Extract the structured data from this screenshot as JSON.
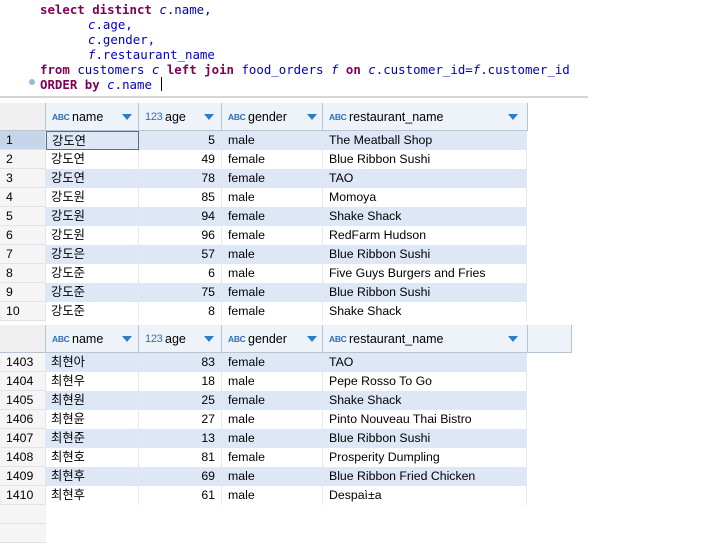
{
  "query": {
    "line1": {
      "kw": "select distinct ",
      "alias": "c",
      "rest": ".name,"
    },
    "line2": {
      "alias": "c",
      "rest": ".age,"
    },
    "line3": {
      "alias": "c",
      "rest": ".gender,"
    },
    "line4": {
      "alias": "f",
      "rest": ".restaurant_name"
    },
    "line5": {
      "kw1": "from ",
      "t1": "customers ",
      "a1": "c",
      "kw2": " left join ",
      "t2": "food_orders ",
      "a2": "f",
      "kw3": " on ",
      "a3": "c",
      "r3": ".customer_id=",
      "a4": "f",
      "r4": ".customer_id"
    },
    "line6": {
      "kw": "ORDER by ",
      "alias": "c",
      "rest": ".name "
    }
  },
  "columns": [
    {
      "type_icon": "ABC",
      "label": "name"
    },
    {
      "type_icon": "123",
      "label": "age"
    },
    {
      "type_icon": "ABC",
      "label": "gender"
    },
    {
      "type_icon": "ABC",
      "label": "restaurant_name"
    }
  ],
  "top_rows": [
    {
      "n": "1",
      "name": "강도연",
      "age": "5",
      "gender": "male",
      "restaurant": "The Meatball Shop"
    },
    {
      "n": "2",
      "name": "강도연",
      "age": "49",
      "gender": "female",
      "restaurant": "Blue Ribbon Sushi"
    },
    {
      "n": "3",
      "name": "강도연",
      "age": "78",
      "gender": "female",
      "restaurant": "TAO"
    },
    {
      "n": "4",
      "name": "강도원",
      "age": "85",
      "gender": "male",
      "restaurant": "Momoya"
    },
    {
      "n": "5",
      "name": "강도원",
      "age": "94",
      "gender": "female",
      "restaurant": "Shake Shack"
    },
    {
      "n": "6",
      "name": "강도원",
      "age": "96",
      "gender": "female",
      "restaurant": "RedFarm Hudson"
    },
    {
      "n": "7",
      "name": "강도은",
      "age": "57",
      "gender": "male",
      "restaurant": "Blue Ribbon Sushi"
    },
    {
      "n": "8",
      "name": "강도준",
      "age": "6",
      "gender": "male",
      "restaurant": "Five Guys Burgers and Fries"
    },
    {
      "n": "9",
      "name": "강도준",
      "age": "75",
      "gender": "female",
      "restaurant": "Blue Ribbon Sushi"
    },
    {
      "n": "10",
      "name": "강도준",
      "age": "8",
      "gender": "female",
      "restaurant": "Shake Shack"
    }
  ],
  "bottom_rows": [
    {
      "n": "1403",
      "name": "최현아",
      "age": "83",
      "gender": "female",
      "restaurant": "TAO"
    },
    {
      "n": "1404",
      "name": "최현우",
      "age": "18",
      "gender": "male",
      "restaurant": "Pepe Rosso To Go"
    },
    {
      "n": "1405",
      "name": "최현원",
      "age": "25",
      "gender": "female",
      "restaurant": "Shake Shack"
    },
    {
      "n": "1406",
      "name": "최현윤",
      "age": "27",
      "gender": "male",
      "restaurant": "Pinto Nouveau Thai Bistro"
    },
    {
      "n": "1407",
      "name": "최현준",
      "age": "13",
      "gender": "male",
      "restaurant": "Blue Ribbon Sushi"
    },
    {
      "n": "1408",
      "name": "최현호",
      "age": "81",
      "gender": "female",
      "restaurant": "Prosperity Dumpling"
    },
    {
      "n": "1409",
      "name": "최현후",
      "age": "69",
      "gender": "male",
      "restaurant": "Blue Ribbon Fried Chicken"
    },
    {
      "n": "1410",
      "name": "최현후",
      "age": "61",
      "gender": "male",
      "restaurant": "Despaì±a"
    }
  ]
}
